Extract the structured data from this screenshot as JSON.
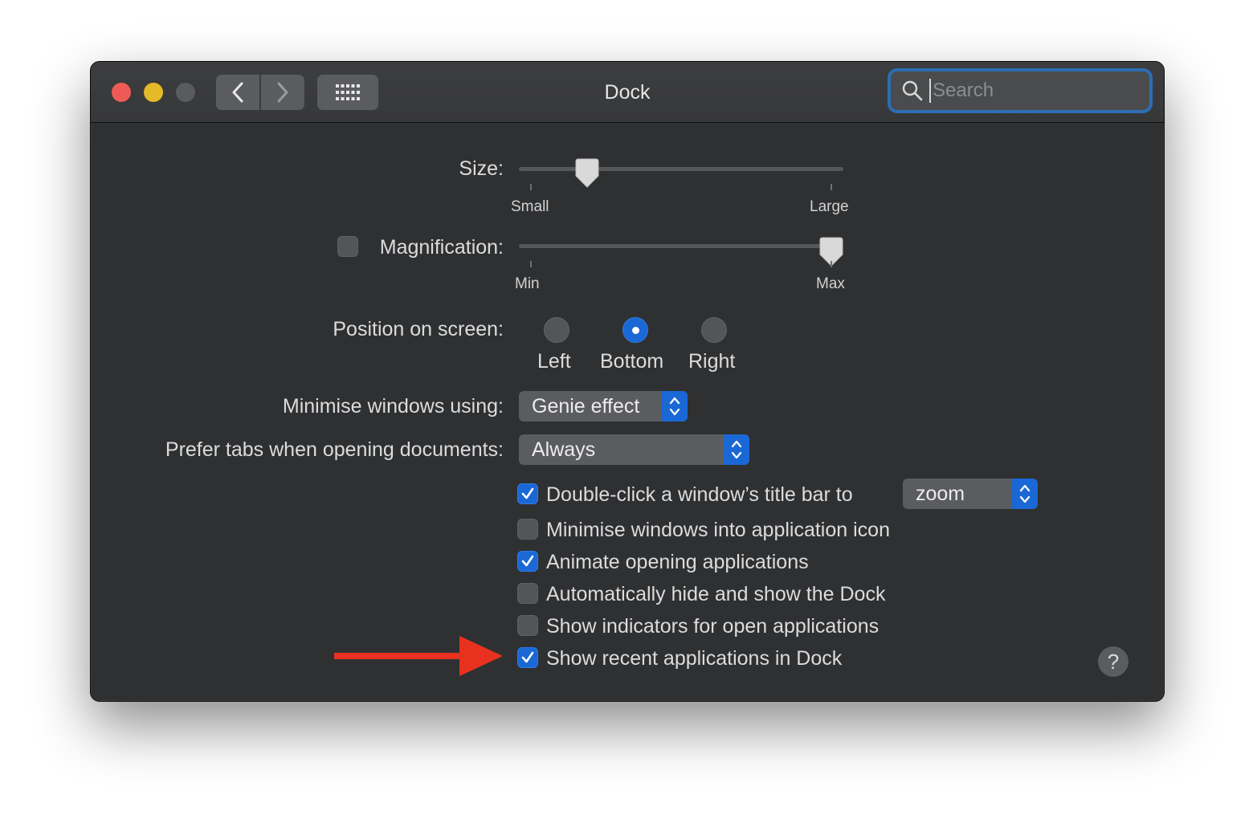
{
  "window": {
    "title": "Dock",
    "search_placeholder": "Search"
  },
  "toolbar": {
    "back_icon": "chevron-left-icon",
    "forward_icon": "chevron-right-icon",
    "grid_icon": "grid-icon"
  },
  "size": {
    "label": "Size:",
    "min_label": "Small",
    "max_label": "Large",
    "value_fraction": 0.21
  },
  "magnification": {
    "label": "Magnification:",
    "checked": false,
    "min_label": "Min",
    "max_label": "Max",
    "value_fraction": 0.97
  },
  "position": {
    "label": "Position on screen:",
    "options": [
      "Left",
      "Bottom",
      "Right"
    ],
    "selected": "Bottom"
  },
  "minimise": {
    "label": "Minimise windows using:",
    "value": "Genie effect"
  },
  "prefer_tabs": {
    "label": "Prefer tabs when opening documents:",
    "value": "Always"
  },
  "options": [
    {
      "label": "Double-click a window’s title bar to",
      "checked": true
    },
    {
      "label": "Minimise windows into application icon",
      "checked": false
    },
    {
      "label": "Animate opening applications",
      "checked": true
    },
    {
      "label": "Automatically hide and show the Dock",
      "checked": false
    },
    {
      "label": "Show indicators for open applications",
      "checked": false
    },
    {
      "label": "Show recent applications in Dock",
      "checked": true
    }
  ],
  "double_click_action": "zoom",
  "help_label": "?",
  "annotation": {
    "arrow_color": "#e8321f",
    "points_to": "Show recent applications in Dock"
  },
  "colors": {
    "accent": "#1a68d6",
    "window_bg": "#2f3032",
    "close": "#ee5b56",
    "minimize": "#e6b928"
  }
}
